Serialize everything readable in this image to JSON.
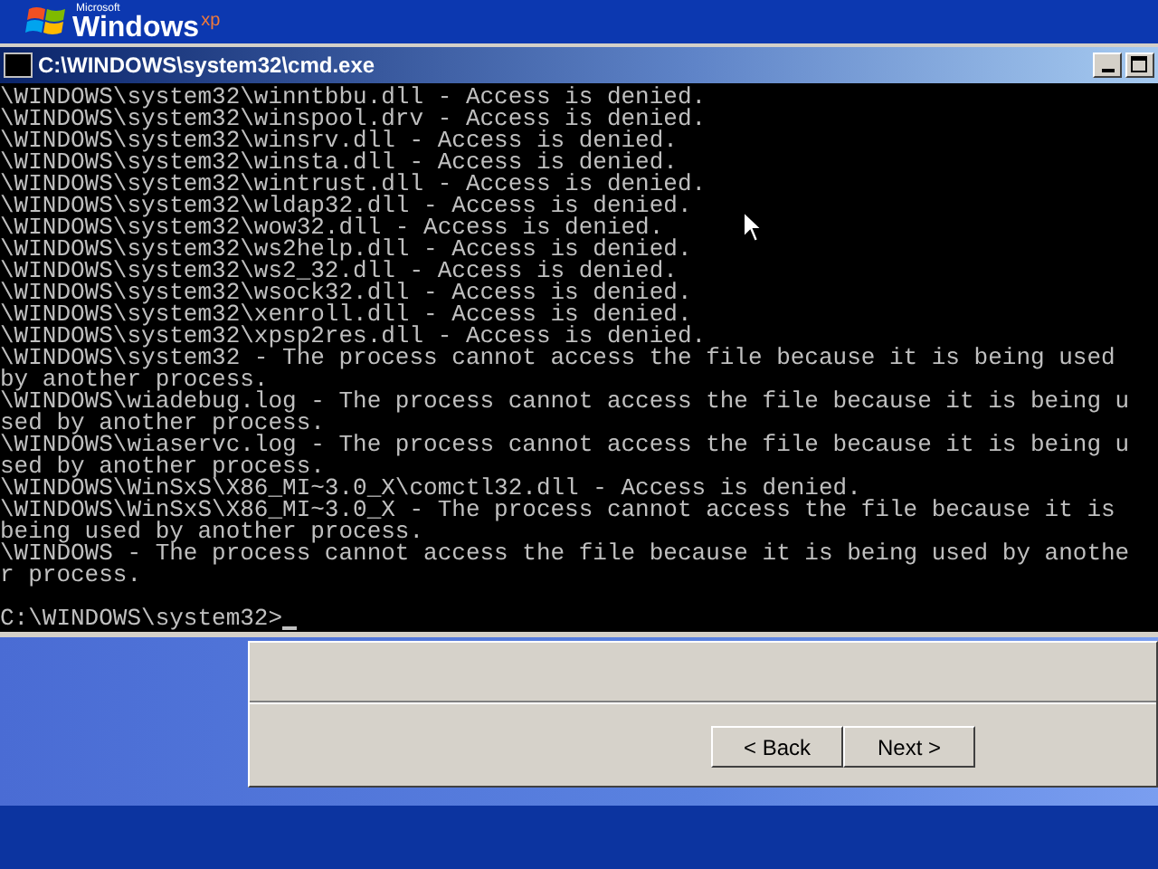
{
  "logo": {
    "company": "Microsoft",
    "product": "Windows",
    "edition": "xp"
  },
  "window": {
    "title": "C:\\WINDOWS\\system32\\cmd.exe"
  },
  "console": {
    "lines": [
      "\\WINDOWS\\system32\\winntbbu.dll - Access is denied.",
      "\\WINDOWS\\system32\\winspool.drv - Access is denied.",
      "\\WINDOWS\\system32\\winsrv.dll - Access is denied.",
      "\\WINDOWS\\system32\\winsta.dll - Access is denied.",
      "\\WINDOWS\\system32\\wintrust.dll - Access is denied.",
      "\\WINDOWS\\system32\\wldap32.dll - Access is denied.",
      "\\WINDOWS\\system32\\wow32.dll - Access is denied.",
      "\\WINDOWS\\system32\\ws2help.dll - Access is denied.",
      "\\WINDOWS\\system32\\ws2_32.dll - Access is denied.",
      "\\WINDOWS\\system32\\wsock32.dll - Access is denied.",
      "\\WINDOWS\\system32\\xenroll.dll - Access is denied.",
      "\\WINDOWS\\system32\\xpsp2res.dll - Access is denied.",
      "\\WINDOWS\\system32 - The process cannot access the file because it is being used",
      "by another process.",
      "\\WINDOWS\\wiadebug.log - The process cannot access the file because it is being u",
      "sed by another process.",
      "\\WINDOWS\\wiaservc.log - The process cannot access the file because it is being u",
      "sed by another process.",
      "\\WINDOWS\\WinSxS\\X86_MI~3.0_X\\comctl32.dll - Access is denied.",
      "\\WINDOWS\\WinSxS\\X86_MI~3.0_X - The process cannot access the file because it is",
      "being used by another process.",
      "\\WINDOWS - The process cannot access the file because it is being used by anothe",
      "r process."
    ],
    "prompt": "C:\\WINDOWS\\system32>"
  },
  "buttons": [
    {
      "label": "< Back"
    },
    {
      "label": "Next >"
    }
  ]
}
